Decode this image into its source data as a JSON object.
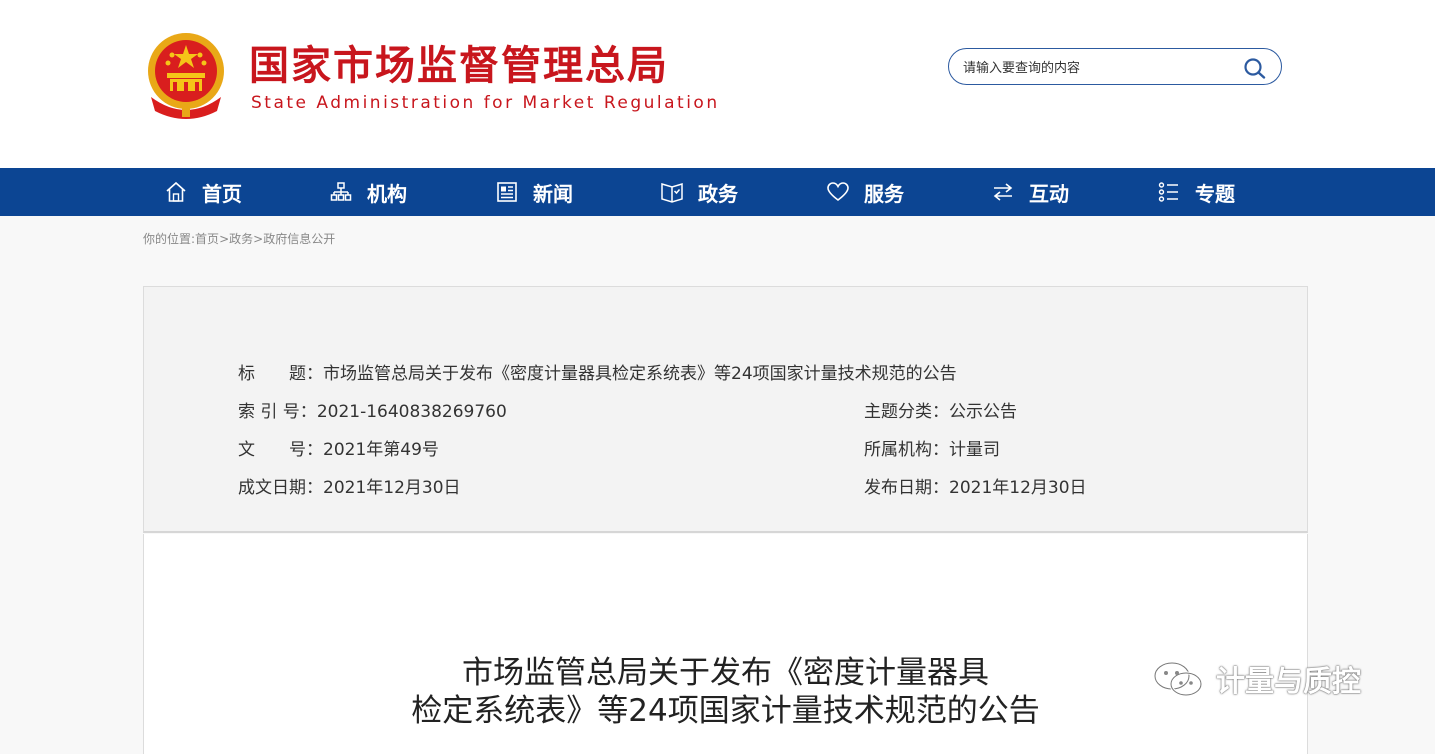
{
  "header": {
    "title": "国家市场监督管理总局",
    "subtitle": "State Administration for Market Regulation",
    "search_placeholder": "请输入要查询的内容"
  },
  "nav": [
    {
      "label": "首页",
      "icon": "home-icon"
    },
    {
      "label": "机构",
      "icon": "org-chart-icon"
    },
    {
      "label": "新闻",
      "icon": "newspaper-icon"
    },
    {
      "label": "政务",
      "icon": "open-book-icon"
    },
    {
      "label": "服务",
      "icon": "heart-icon"
    },
    {
      "label": "互动",
      "icon": "swap-arrows-icon"
    },
    {
      "label": "专题",
      "icon": "list-icon"
    }
  ],
  "breadcrumb": {
    "prefix": "你的位置:",
    "items": [
      "首页",
      "政务",
      "政府信息公开"
    ],
    "separator": ">"
  },
  "meta": {
    "title_label": "标　　题：",
    "title_value": "市场监管总局关于发布《密度计量器具检定系统表》等24项国家计量技术规范的公告",
    "index_label": "索 引 号：",
    "index_value": "2021-1640838269760",
    "topic_label": "主题分类：",
    "topic_value": "公示公告",
    "docno_label": "文　　号：",
    "docno_value": "2021年第49号",
    "org_label": "所属机构：",
    "org_value": "计量司",
    "created_label": "成文日期：",
    "created_value": "2021年12月30日",
    "published_label": "发布日期：",
    "published_value": "2021年12月30日"
  },
  "document": {
    "title_line1": "市场监管总局关于发布《密度计量器具",
    "title_line2": "检定系统表》等24项国家计量技术规范的公告"
  },
  "watermark": {
    "text": "计量与质控",
    "icon": "wechat-icon"
  },
  "colors": {
    "brand_red": "#c8161d",
    "nav_blue": "#0c4593",
    "search_border": "#2c5aa0"
  }
}
